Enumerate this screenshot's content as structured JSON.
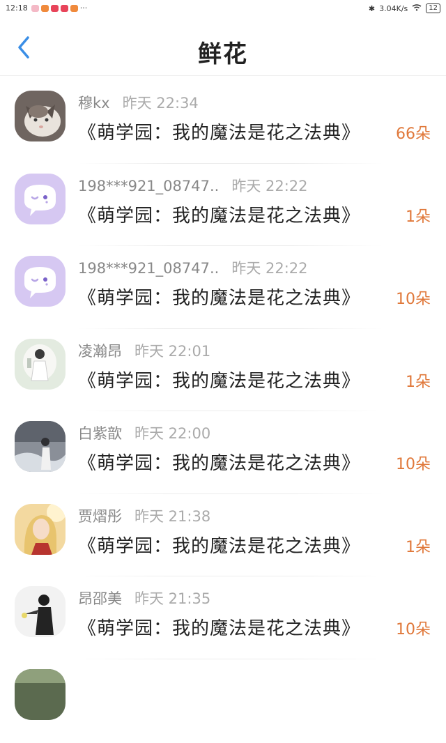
{
  "status_bar": {
    "time": "12:18",
    "more": "···",
    "network_speed": "3.04K/s",
    "battery": "12"
  },
  "header": {
    "title": "鲜花"
  },
  "colors": {
    "accent_blue": "#3a8ee6",
    "count_orange": "#e0783a"
  },
  "gifts": [
    {
      "name": "穆kx",
      "time": "昨天 22:34",
      "book": "《萌学园：我的魔法是花之法典》",
      "count": "66朵",
      "avatar": "cat-avatar"
    },
    {
      "name": "198***921_08747..",
      "time": "昨天 22:22",
      "book": "《萌学园：我的魔法是花之法典》",
      "count": "1朵",
      "avatar": "default-chat-avatar"
    },
    {
      "name": "198***921_08747..",
      "time": "昨天 22:22",
      "book": "《萌学园：我的魔法是花之法典》",
      "count": "10朵",
      "avatar": "default-chat-avatar"
    },
    {
      "name": "凌瀚昂",
      "time": "昨天 22:01",
      "book": "《萌学园：我的魔法是花之法典》",
      "count": "1朵",
      "avatar": "photo-avatar"
    },
    {
      "name": "白紫歆",
      "time": "昨天 22:00",
      "book": "《萌学园：我的魔法是花之法典》",
      "count": "10朵",
      "avatar": "photo-avatar"
    },
    {
      "name": "贾熠彤",
      "time": "昨天 21:38",
      "book": "《萌学园：我的魔法是花之法典》",
      "count": "1朵",
      "avatar": "photo-avatar"
    },
    {
      "name": "昂邵美",
      "time": "昨天 21:35",
      "book": "《萌学园：我的魔法是花之法典》",
      "count": "10朵",
      "avatar": "photo-avatar"
    }
  ]
}
